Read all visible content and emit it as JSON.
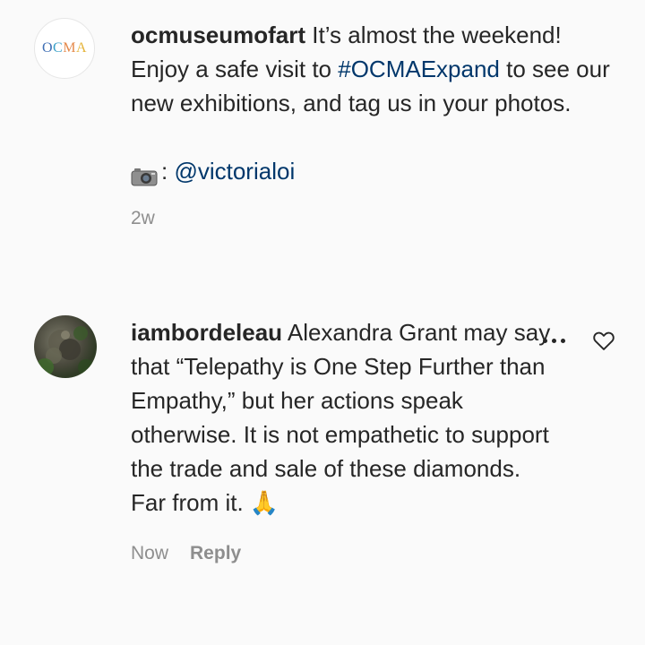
{
  "caption": {
    "logo_text": {
      "part1": "O",
      "part2": "C",
      "part3": "M",
      "part4": "A"
    },
    "username": "ocmuseumofart",
    "text_before_tag": " It’s almost the weekend! Enjoy a safe visit to ",
    "hashtag": "#OCMAExpand",
    "text_after_tag": " to see our new exhibitions, and tag us in your photos.",
    "credit_separator": ": ",
    "credit_mention": "@victorialoi",
    "timestamp": "2w"
  },
  "comment": {
    "username": "iambordeleau",
    "text": " Alexandra Grant may say that “Telepathy is One Step Further than Empathy,” but her actions speak otherwise. It is not empathetic to support the trade and sale of these diamonds. Far from it. ",
    "emoji": "🙏",
    "timestamp": "Now",
    "reply_label": "Reply"
  },
  "icons": {
    "camera": "camera-icon",
    "more": "more-options-icon",
    "like": "heart-icon"
  },
  "colors": {
    "link": "#00376b",
    "meta": "#8e8e8e",
    "text": "#262626"
  }
}
